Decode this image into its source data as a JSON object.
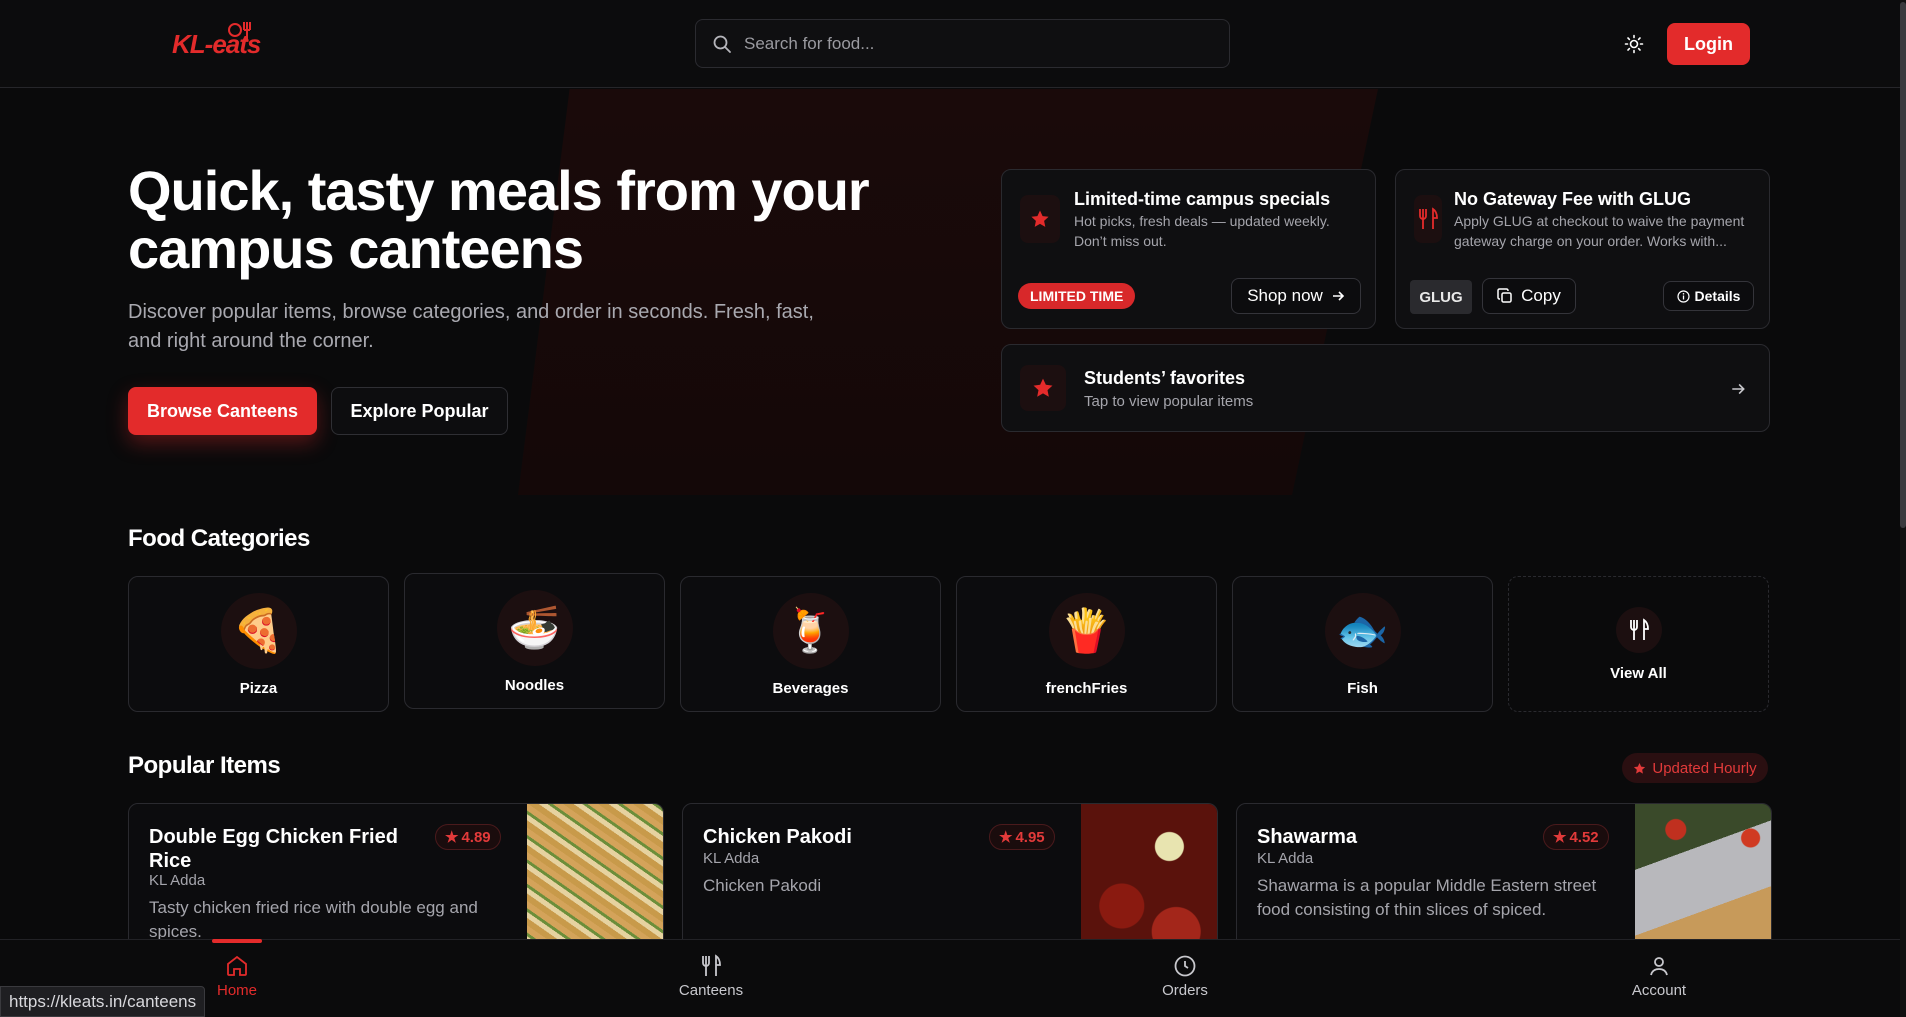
{
  "brand": {
    "logo_text": "KL-eats",
    "accent": "#e32b2b"
  },
  "header": {
    "search_placeholder": "Search for food...",
    "login_label": "Login"
  },
  "hero": {
    "title": "Quick, tasty meals from your campus canteens",
    "subtitle": "Discover popular items, browse categories, and order in seconds. Fresh, fast, and right around the corner.",
    "browse_label": "Browse Canteens",
    "explore_label": "Explore Popular"
  },
  "promos": [
    {
      "title": "Limited-time campus specials",
      "desc": "Hot picks, fresh deals — updated weekly. Don’t miss out.",
      "badge": "LIMITED TIME",
      "cta": "Shop now"
    },
    {
      "title": "No Gateway Fee with GLUG",
      "desc": "Apply GLUG at checkout to waive the payment gateway charge on your order. Works with...",
      "code": "GLUG",
      "copy_label": "Copy",
      "details_label": "Details"
    }
  ],
  "favorites": {
    "title": "Students’ favorites",
    "subtitle": "Tap to view popular items"
  },
  "categories_title": "Food Categories",
  "categories": [
    {
      "label": "Pizza",
      "icon": "pizza-icon"
    },
    {
      "label": "Noodles",
      "icon": "noodles-icon"
    },
    {
      "label": "Beverages",
      "icon": "beverage-icon"
    },
    {
      "label": "frenchFries",
      "icon": "fries-icon"
    },
    {
      "label": "Fish",
      "icon": "fish-icon"
    },
    {
      "label": "View All",
      "icon": "fork-knife-icon"
    }
  ],
  "popular": {
    "title": "Popular Items",
    "badge": "Updated Hourly",
    "items": [
      {
        "name": "Double Egg Chicken Fried Rice",
        "rating": "4.89",
        "canteen": "KL Adda",
        "desc": "Tasty chicken fried rice with double egg and spices."
      },
      {
        "name": "Chicken Pakodi",
        "rating": "4.95",
        "canteen": "KL Adda",
        "desc": "Chicken Pakodi"
      },
      {
        "name": "Shawarma",
        "rating": "4.52",
        "canteen": "KL Adda",
        "desc": "Shawarma is a popular Middle Eastern street food consisting of thin slices of spiced."
      }
    ]
  },
  "bottom_nav": [
    {
      "label": "Home",
      "active": true
    },
    {
      "label": "Canteens"
    },
    {
      "label": "Orders"
    },
    {
      "label": "Account"
    }
  ],
  "status_url": "https://kleats.in/canteens"
}
